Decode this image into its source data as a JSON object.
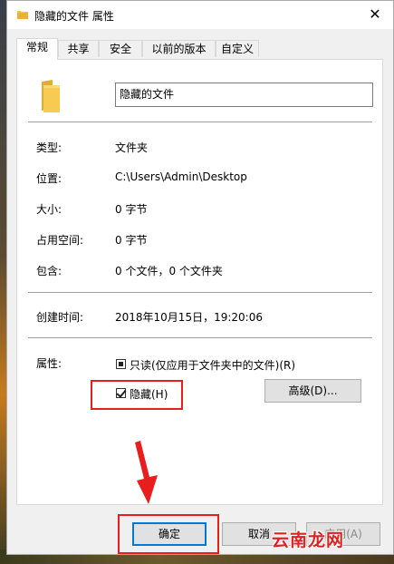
{
  "window": {
    "title": "隐藏的文件 属性",
    "close_symbol": "✕"
  },
  "tabs": [
    {
      "label": "常规",
      "active": true
    },
    {
      "label": "共享",
      "active": false
    },
    {
      "label": "安全",
      "active": false
    },
    {
      "label": "以前的版本",
      "active": false
    },
    {
      "label": "自定义",
      "active": false
    }
  ],
  "general": {
    "name_value": "隐藏的文件",
    "rows": [
      {
        "label": "类型:",
        "value": "文件夹"
      },
      {
        "label": "位置:",
        "value": "C:\\Users\\Admin\\Desktop"
      },
      {
        "label": "大小:",
        "value": "0 字节"
      },
      {
        "label": "占用空间:",
        "value": "0 字节"
      },
      {
        "label": "包含:",
        "value": "0 个文件，0 个文件夹"
      }
    ],
    "created_label": "创建时间:",
    "created_value": "2018年10月15日，19:20:06",
    "attributes_label": "属性:",
    "readonly_label": "只读(仅应用于文件夹中的文件)(R)",
    "readonly_state": "indeterminate",
    "hidden_label": "隐藏(H)",
    "hidden_checked": true,
    "advanced_label": "高级(D)..."
  },
  "buttons": {
    "ok": "确定",
    "cancel": "取消",
    "apply": "应用(A)"
  },
  "watermark": "云南龙网",
  "colors": {
    "highlight": "#e81d1d",
    "primary_border": "#0078d7",
    "folder": "#f5c543"
  },
  "icons": {
    "title": "folder-icon",
    "close": "close-icon",
    "large": "folder-icon"
  }
}
